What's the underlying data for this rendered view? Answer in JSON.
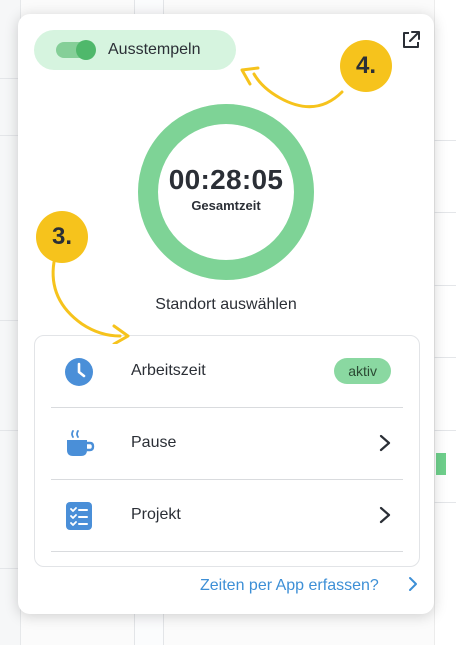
{
  "toggle": {
    "label": "Ausstempeln",
    "state": "on"
  },
  "timer": {
    "value": "00:28:05",
    "label": "Gesamtzeit",
    "progress": 1.0,
    "ring_color": "#7ed396"
  },
  "location": {
    "label": "Standort auswählen"
  },
  "list": {
    "items": [
      {
        "label": "Arbeitszeit",
        "icon": "clock-icon",
        "badge": "aktiv"
      },
      {
        "label": "Pause",
        "icon": "coffee-cup-icon"
      },
      {
        "label": "Projekt",
        "icon": "checklist-icon"
      }
    ]
  },
  "footer": {
    "link": "Zeiten per App erfassen?"
  },
  "annotations": {
    "step3": "3.",
    "step4": "4."
  },
  "colors": {
    "accent_green": "#4fb86b",
    "badge_yellow": "#f6c31c",
    "link_blue": "#3d8fd6",
    "icon_blue": "#4a8fd8"
  }
}
